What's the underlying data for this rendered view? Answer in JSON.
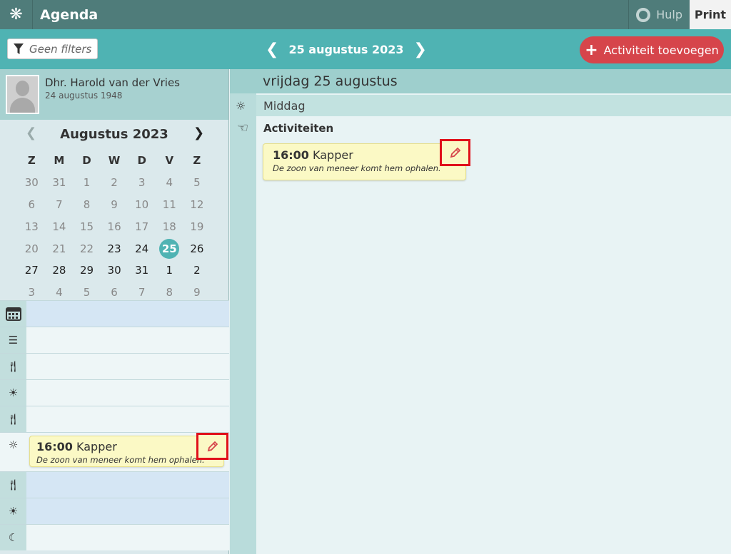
{
  "app": {
    "title": "Agenda",
    "help_label": "Hulp",
    "print_label": "Print"
  },
  "toolbar": {
    "filter_label": "Geen filters",
    "current_date": "25 augustus 2023",
    "add_button_label": "Activiteit toevoegen"
  },
  "profile": {
    "name": "Dhr. Harold van der Vries",
    "dob": "24 augustus 1948"
  },
  "calendar": {
    "title": "Augustus 2023",
    "weekdays": [
      "Z",
      "M",
      "D",
      "W",
      "D",
      "V",
      "Z"
    ],
    "weeks": [
      [
        "30",
        "31",
        "1",
        "2",
        "3",
        "4",
        "5"
      ],
      [
        "6",
        "7",
        "8",
        "9",
        "10",
        "11",
        "12"
      ],
      [
        "13",
        "14",
        "15",
        "16",
        "17",
        "18",
        "19"
      ],
      [
        "20",
        "21",
        "22",
        "23",
        "24",
        "25",
        "26"
      ],
      [
        "27",
        "28",
        "29",
        "30",
        "31",
        "1",
        "2"
      ],
      [
        "3",
        "4",
        "5",
        "6",
        "7",
        "8",
        "9"
      ]
    ],
    "selected": "25"
  },
  "day": {
    "header": "vrijdag 25 augustus",
    "daypart": "Middag",
    "activities_label": "Activiteiten"
  },
  "activity": {
    "time": "16:00",
    "title": "Kapper",
    "description": "De zoon van meneer komt hem ophalen."
  },
  "icons": {
    "logo": "snowflake-logo-icon",
    "help": "lifebuoy-icon",
    "filter": "funnel-icon",
    "prev": "chevron-left-icon",
    "next": "chevron-right-icon",
    "add": "plus-icon",
    "edit": "pencil-icon",
    "calendar": "calendar-icon",
    "sunrise": "sunrise-icon",
    "meal": "fork-knife-icon",
    "afternoon": "sun-icon",
    "evening": "sunset-icon",
    "night": "moon-icon",
    "hand": "hand-icon"
  },
  "colors": {
    "topbar": "#4f7c7a",
    "toolbar": "#4fb3b3",
    "accent_red": "#d6454b",
    "card": "#fbf9c5",
    "highlight": "#e0101a"
  }
}
